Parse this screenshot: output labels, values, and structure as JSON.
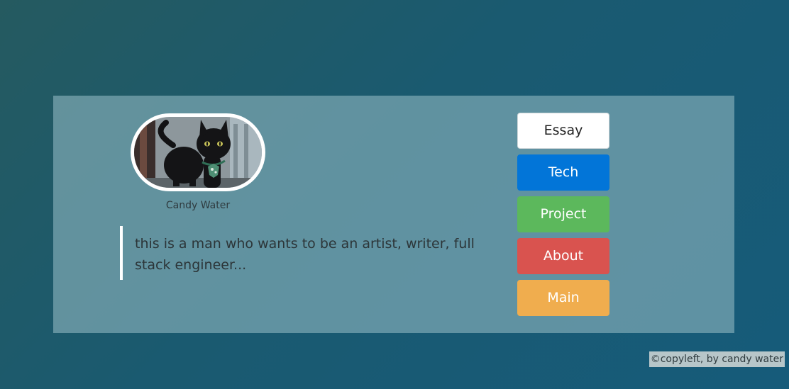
{
  "profile": {
    "name": "Candy Water",
    "bio": "this is a man who wants to be an artist, writer, full stack engineer..."
  },
  "nav": {
    "essay": "Essay",
    "tech": "Tech",
    "project": "Project",
    "about": "About",
    "main": "Main"
  },
  "footer": {
    "text": "©copyleft, by candy water"
  },
  "colors": {
    "tech": "#0275d8",
    "project": "#5cb85c",
    "about": "#d9534f",
    "main": "#f0ad4e"
  }
}
